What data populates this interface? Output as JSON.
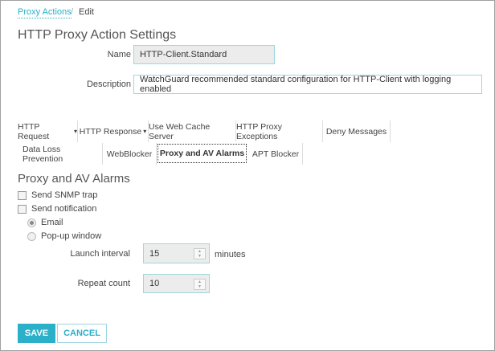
{
  "breadcrumb": {
    "link": "Proxy Actions",
    "separator": "/",
    "current": "Edit"
  },
  "page_title": "HTTP Proxy Action Settings",
  "form": {
    "name_label": "Name",
    "name_value": "HTTP-Client.Standard",
    "description_label": "Description",
    "description_value": "WatchGuard recommended standard configuration for HTTP-Client with logging enabled"
  },
  "tabs": [
    {
      "label": "HTTP Request",
      "dropdown": "▾"
    },
    {
      "label": "HTTP Response",
      "dropdown": "▾"
    },
    {
      "label": "Use Web Cache Server"
    },
    {
      "label": "HTTP Proxy Exceptions"
    },
    {
      "label": "Deny Messages"
    },
    {
      "label": "Data Loss Prevention"
    },
    {
      "label": "WebBlocker"
    },
    {
      "label": "Proxy and AV Alarms",
      "active": true
    },
    {
      "label": "APT Blocker"
    }
  ],
  "section": {
    "title": "Proxy and AV Alarms",
    "send_snmp_trap": {
      "label": "Send SNMP trap",
      "checked": false
    },
    "send_notification": {
      "label": "Send notification",
      "checked": false
    },
    "radio_email": {
      "label": "Email",
      "selected": true
    },
    "radio_popup": {
      "label": "Pop-up window",
      "selected": false
    },
    "launch_interval": {
      "label": "Launch interval",
      "value": "15",
      "unit": "minutes"
    },
    "repeat_count": {
      "label": "Repeat count",
      "value": "10"
    }
  },
  "buttons": {
    "save": "SAVE",
    "cancel": "CANCEL"
  },
  "colors": {
    "accent": "#2ab0c8"
  }
}
